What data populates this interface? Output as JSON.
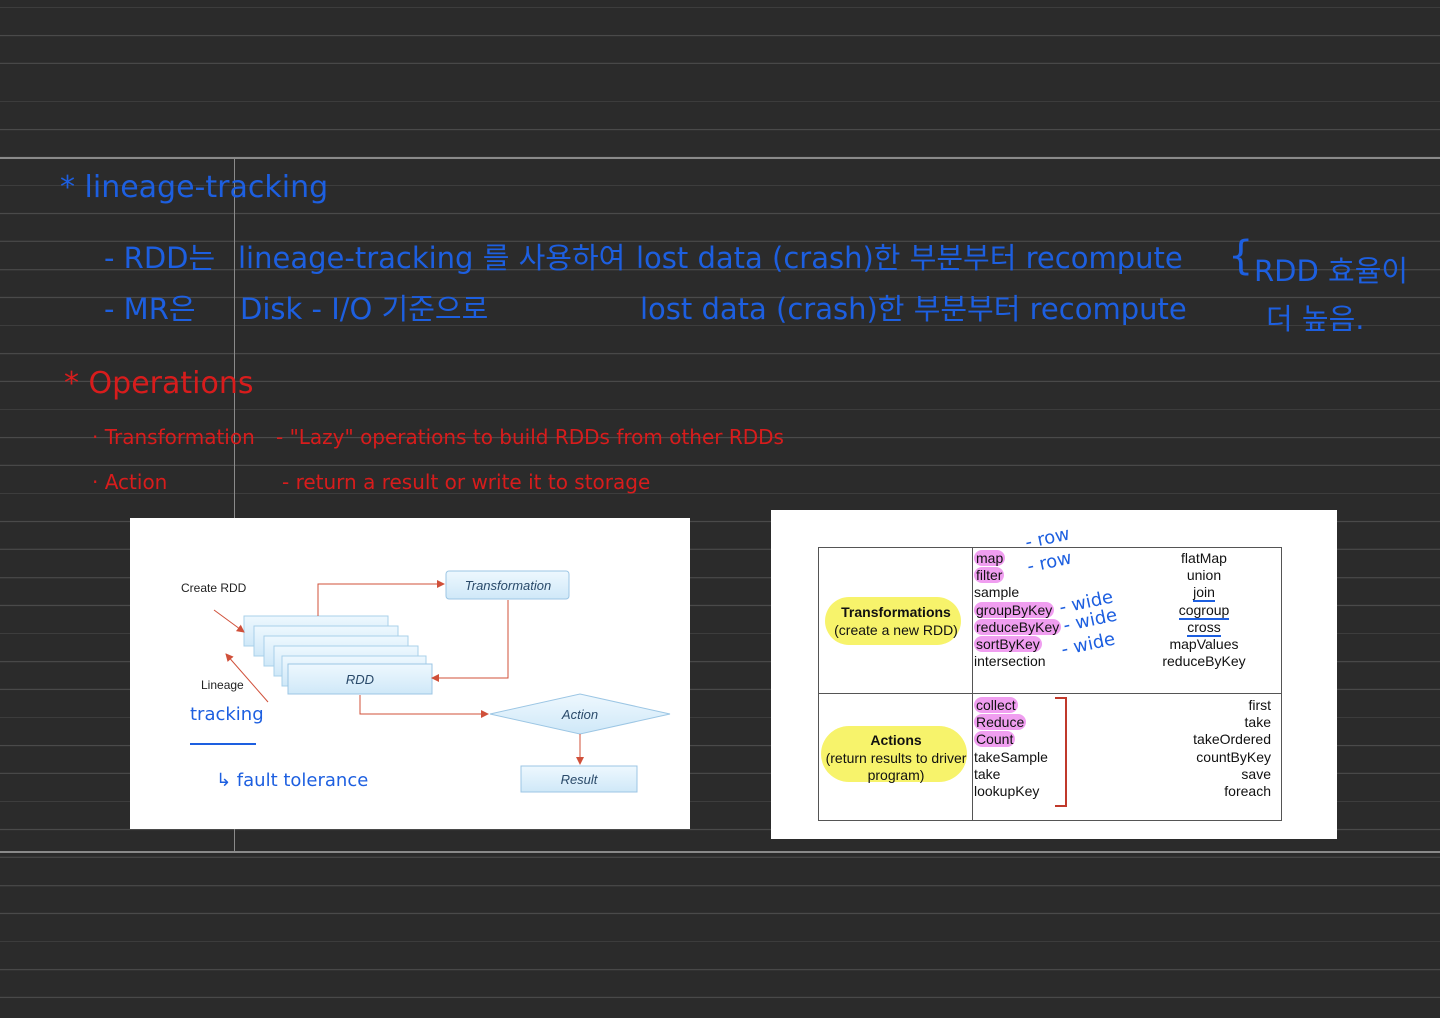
{
  "notes": {
    "lineage_heading": "* lineage-tracking",
    "lineage_line1": {
      "a": "- RDD는",
      "b": "lineage-tracking 를 사용하여",
      "c": "lost data (crash)한 부분부터 recompute",
      "d": "RDD 효율이"
    },
    "lineage_line2": {
      "a": "- MR은",
      "b": "Disk - I/O 기준으로",
      "c": "lost data (crash)한 부분부터 recompute",
      "d": "더 높음."
    },
    "operations_heading": "* Operations",
    "transformation_line": {
      "name": "· Transformation",
      "desc": "- \"Lazy\" operations to build RDDs from other RDDs"
    },
    "action_line": {
      "name": "· Action",
      "desc": "- return a result or write it to storage"
    }
  },
  "diagram": {
    "create_rdd": "Create RDD",
    "lineage": "Lineage",
    "transformation": "Transformation",
    "rdd": "RDD",
    "action": "Action",
    "result": "Result",
    "annotation_tracking": "tracking",
    "annotation_fault": "↳ fault tolerance"
  },
  "op_table": {
    "transformations": {
      "title": "Transformations",
      "subtitle": "(create a new RDD)",
      "left_list": [
        "map",
        "filter",
        "sample",
        "groupByKey",
        "reduceByKey",
        "sortByKey",
        "intersection"
      ],
      "right_list": [
        "flatMap",
        "union",
        "join",
        "cogroup",
        "cross",
        "mapValues",
        "reduceByKey"
      ]
    },
    "actions": {
      "title": "Actions",
      "subtitle_1": "(return results to driver",
      "subtitle_2": "program)",
      "left_list": [
        "collect",
        "Reduce",
        "Count",
        "takeSample",
        "take",
        "lookupKey"
      ],
      "right_list": [
        "first",
        "take",
        "takeOrdered",
        "countByKey",
        "save",
        "foreach"
      ]
    },
    "annotations": {
      "row1": "- row",
      "row2": "- row",
      "wide1": "- wide",
      "wide2": "- wide",
      "wide3": "- wide"
    }
  },
  "colors": {
    "background": "#2b2b2b",
    "ink_blue": "#1d5fe0",
    "ink_red": "#d81c1c",
    "highlight_pink": "#f09ef0",
    "highlight_yellow": "#f6f25b",
    "diagram_box": "#dff0fb"
  }
}
